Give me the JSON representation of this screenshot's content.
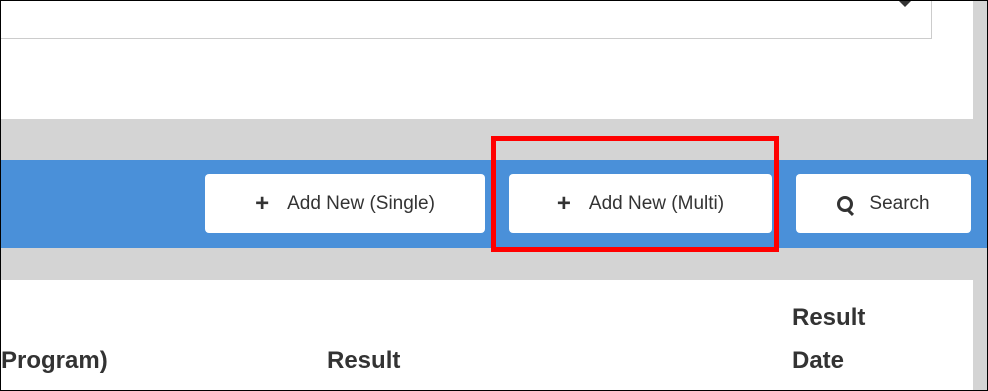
{
  "toolbar": {
    "add_single_label": "Add New (Single)",
    "add_multi_label": "Add New (Multi)",
    "search_label": "Search"
  },
  "table": {
    "headers": [
      "Program)",
      "Result",
      "Result Date"
    ],
    "header_lines": {
      "program": "Program)",
      "result": "Result",
      "result_date_line1": "Result",
      "result_date_line2": "Date"
    }
  },
  "colors": {
    "toolbar_bg": "#4a90d9",
    "highlight": "#ff0000",
    "page_bg": "#d4d4d4"
  },
  "icons": {
    "add_single": "plus-icon",
    "add_multi": "plus-icon",
    "search": "search-icon",
    "dropdown": "caret-down-icon"
  }
}
